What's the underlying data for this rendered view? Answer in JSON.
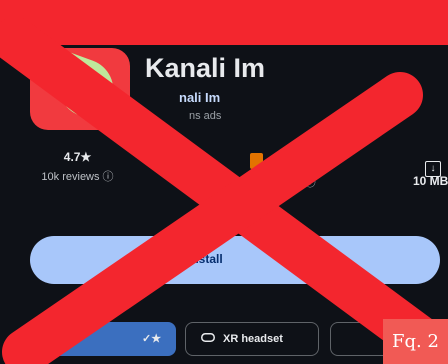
{
  "app": {
    "title": "Kanali Im",
    "developer": "nali Im",
    "ads_note": "ns ads"
  },
  "stats": {
    "rating": "4.7★",
    "reviews": "10k reviews ⓘ",
    "content_rating": "ce ⓘ",
    "downloads": "10 MB"
  },
  "install": {
    "label": "Install"
  },
  "devices": {
    "phone_fragment": "✓★",
    "xr_headset": "XR headset",
    "xr_icon": "vr-headset-icon"
  },
  "figure": {
    "label": "Fq. 2"
  },
  "colors": {
    "banner": "#f3262e",
    "install_button": "#a8c7fa",
    "background": "#0e1117",
    "cross": "#f3262e",
    "label_box": "#f15a55"
  }
}
